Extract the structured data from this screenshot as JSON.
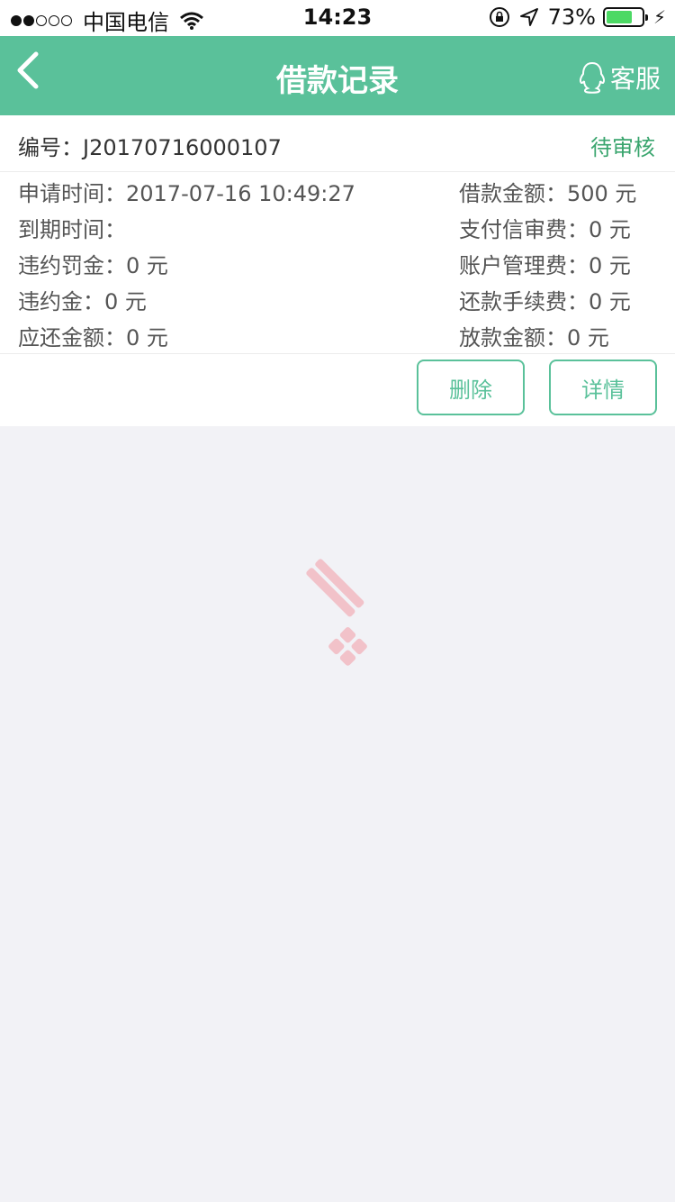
{
  "status_bar": {
    "carrier": "中国电信",
    "time": "14:23",
    "battery": "73%",
    "battery_level": 0.73
  },
  "nav": {
    "title": "借款记录",
    "service_label": "客服",
    "back_icon": "chevron-left-icon",
    "service_icon": "qq-penguin-icon"
  },
  "record": {
    "order_no": "编号：J20170716000107",
    "status": "待审核",
    "left_items": [
      "申请时间：2017-07-16 10:49:27",
      "到期时间：",
      "违约罚金：0 元",
      "违约金：0 元",
      "应还金额：0 元"
    ],
    "right_items": [
      "借款金额：500 元",
      "支付信审费：0 元",
      "账户管理费：0 元",
      "还款手续费：0 元",
      "放款金额：0 元"
    ],
    "delete_label": "删除",
    "detail_label": "详情"
  },
  "colors": {
    "brand": "#5ac19a",
    "status_green": "#3aa56e",
    "background": "#f2f2f6"
  }
}
